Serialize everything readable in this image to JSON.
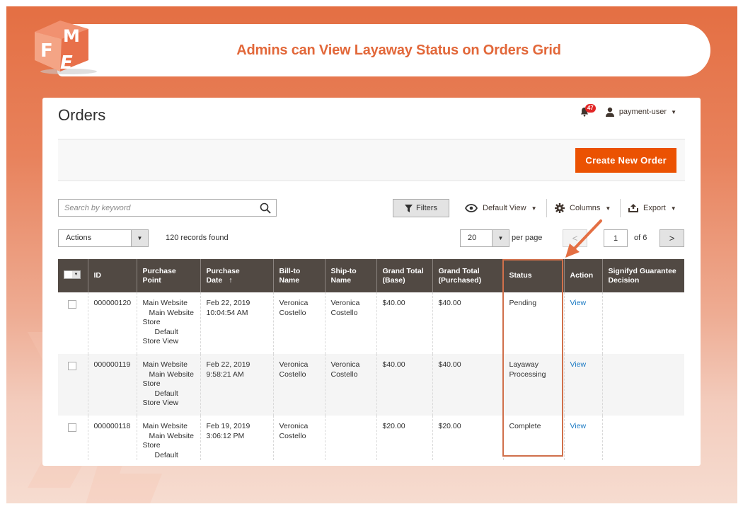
{
  "banner": {
    "title": "Admins can View Layaway Status on Orders Grid",
    "logo_letters": [
      "F",
      "M",
      "E"
    ]
  },
  "colors": {
    "brand_orange": "#e46f43",
    "button_orange": "#eb5202",
    "header_dark": "#514943",
    "link_blue": "#1979c3",
    "highlight": "#d0704b",
    "badge_red": "#e22626"
  },
  "page": {
    "title": "Orders",
    "notifications": {
      "icon": "bell-icon",
      "count": "47"
    },
    "user": {
      "icon": "user-icon",
      "name": "payment-user"
    }
  },
  "action_bar": {
    "create_button": "Create New Order"
  },
  "toolbar": {
    "search_placeholder": "Search by keyword",
    "filters_label": "Filters",
    "view_label": "Default View",
    "columns_label": "Columns",
    "export_label": "Export",
    "actions_label": "Actions",
    "records_found": "120 records found",
    "per_page_value": "20",
    "per_page_label": "per page",
    "current_page": "1",
    "total_pages_label": "of 6"
  },
  "grid": {
    "columns": [
      {
        "key": "select",
        "label": ""
      },
      {
        "key": "id",
        "label": "ID"
      },
      {
        "key": "purchase_point",
        "label": "Purchase Point"
      },
      {
        "key": "purchase_date",
        "label": "Purchase Date",
        "sort": "↑"
      },
      {
        "key": "bill_to",
        "label": "Bill-to Name"
      },
      {
        "key": "ship_to",
        "label": "Ship-to Name"
      },
      {
        "key": "grand_total_base",
        "label": "Grand Total (Base)"
      },
      {
        "key": "grand_total_purchased",
        "label": "Grand Total (Purchased)"
      },
      {
        "key": "status",
        "label": "Status"
      },
      {
        "key": "action",
        "label": "Action"
      },
      {
        "key": "signifyd",
        "label": "Signifyd Guarantee Decision"
      }
    ],
    "rows": [
      {
        "id": "000000120",
        "purchase_point": [
          "Main Website",
          "Main Website",
          "Store",
          "Default",
          "Store View"
        ],
        "purchase_date": [
          "Feb 22, 2019",
          "10:04:54 AM"
        ],
        "bill_to": [
          "Veronica",
          "Costello"
        ],
        "ship_to": [
          "Veronica",
          "Costello"
        ],
        "grand_total_base": "$40.00",
        "grand_total_purchased": "$40.00",
        "status": [
          "Pending"
        ],
        "action": "View",
        "signifyd": ""
      },
      {
        "id": "000000119",
        "purchase_point": [
          "Main Website",
          "Main Website",
          "Store",
          "Default",
          "Store View"
        ],
        "purchase_date": [
          "Feb 22, 2019",
          "9:58:21 AM"
        ],
        "bill_to": [
          "Veronica",
          "Costello"
        ],
        "ship_to": [
          "Veronica",
          "Costello"
        ],
        "grand_total_base": "$40.00",
        "grand_total_purchased": "$40.00",
        "status": [
          "Layaway",
          "Processing"
        ],
        "action": "View",
        "signifyd": ""
      },
      {
        "id": "000000118",
        "purchase_point": [
          "Main Website",
          "Main Website",
          "Store",
          "Default"
        ],
        "purchase_date": [
          "Feb 19, 2019",
          "3:06:12 PM"
        ],
        "bill_to": [
          "Veronica",
          "Costello"
        ],
        "ship_to": [
          "",
          ""
        ],
        "grand_total_base": "$20.00",
        "grand_total_purchased": "$20.00",
        "status": [
          "Complete"
        ],
        "action": "View",
        "signifyd": ""
      }
    ]
  }
}
